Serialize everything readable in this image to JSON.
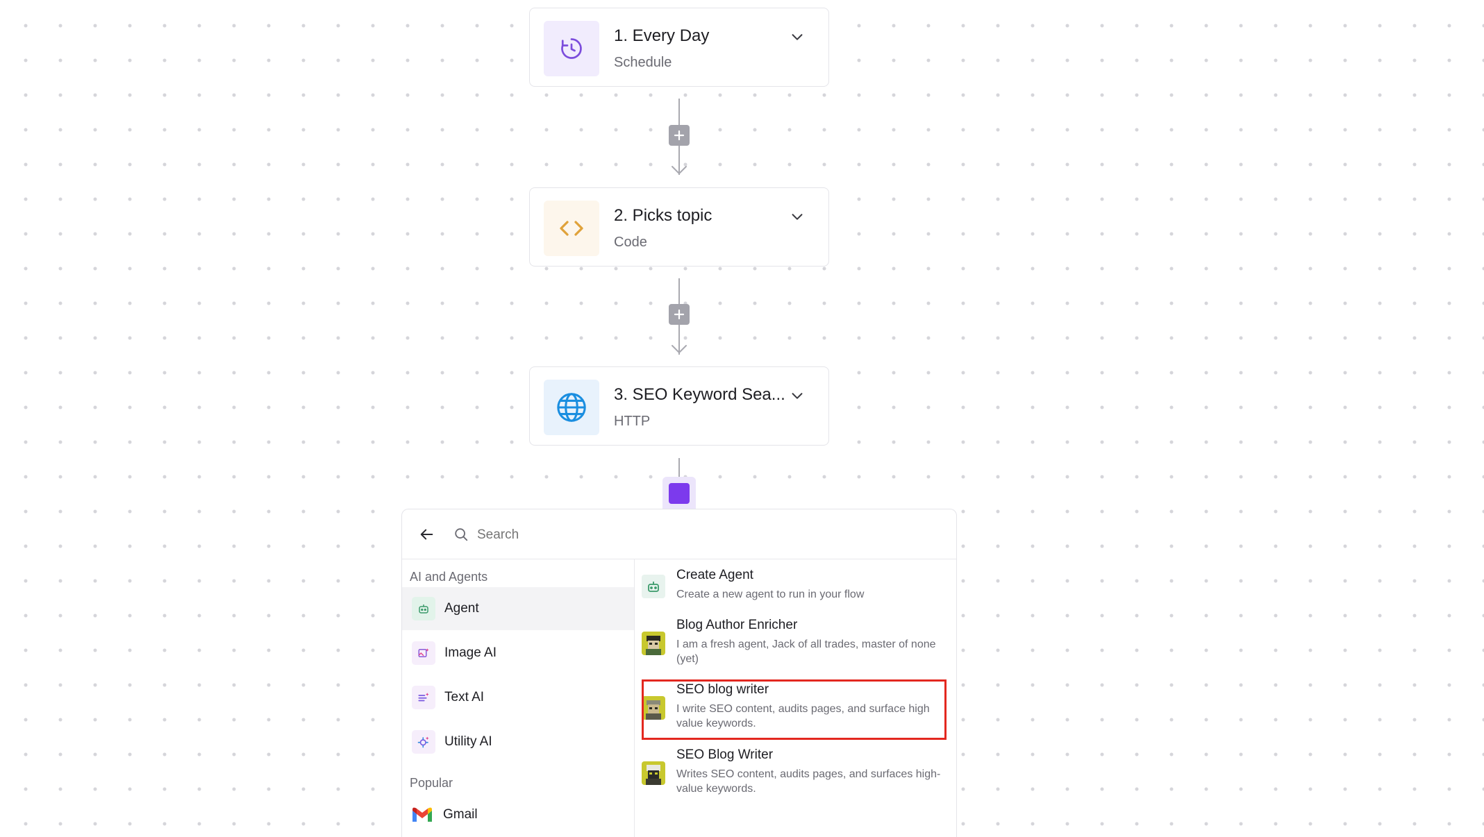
{
  "steps": [
    {
      "title": "1. Every Day",
      "subtitle": "Schedule",
      "icon": "clock-icon",
      "icon_bg": "#f1ecfd",
      "icon_color": "#7c4ddc"
    },
    {
      "title": "2. Picks topic",
      "subtitle": "Code",
      "icon": "code-icon",
      "icon_bg": "#fdf6ec",
      "icon_color": "#e0a23a"
    },
    {
      "title": "3. SEO Keyword Sea...",
      "subtitle": "HTTP",
      "icon": "globe-icon",
      "icon_bg": "#e8f2fc",
      "icon_color": "#1a8ee0"
    }
  ],
  "picker": {
    "search_placeholder": "Search",
    "sections": [
      {
        "label": "AI and Agents",
        "items": [
          {
            "label": "Agent",
            "icon": "robot-icon",
            "active": true
          },
          {
            "label": "Image AI",
            "icon": "image-ai-icon"
          },
          {
            "label": "Text AI",
            "icon": "text-ai-icon"
          },
          {
            "label": "Utility AI",
            "icon": "utility-ai-icon"
          }
        ]
      },
      {
        "label": "Popular",
        "items": [
          {
            "label": "Gmail",
            "icon": "gmail-icon"
          }
        ]
      }
    ],
    "agents": [
      {
        "name": "Create Agent",
        "description": "Create a new agent to run in your flow",
        "icon": "robot-icon"
      },
      {
        "name": "Blog Author Enricher",
        "description": "I am a fresh agent, Jack of all trades, master of none (yet)",
        "icon": "agent-avatar-icon"
      },
      {
        "name": "SEO blog writer",
        "description": "I write SEO content, audits pages, and surface high value keywords.",
        "icon": "agent-avatar-icon",
        "highlighted": true
      },
      {
        "name": "SEO Blog Writer",
        "description": "Writes SEO content, audits pages, and surfaces high-value keywords.",
        "icon": "agent-avatar-icon"
      }
    ]
  },
  "colors": {
    "accent": "#7c3aed",
    "highlight": "#e3281f"
  }
}
